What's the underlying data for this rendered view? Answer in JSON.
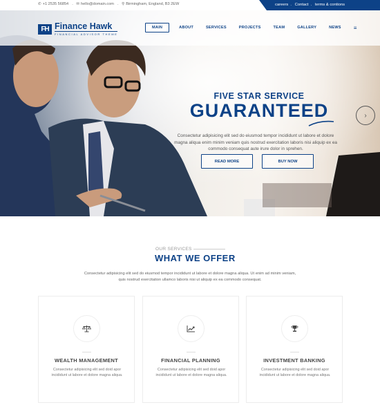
{
  "topbar": {
    "phone": "+1 2535 56854",
    "email": "hello@domain.com",
    "address": "Birmingham, England, B3 2EW",
    "links": [
      "careers",
      "Contact",
      "terms & contions"
    ]
  },
  "brand": {
    "mark": "FH",
    "name": "Finance Hawk",
    "tagline": "FINANCIAL ADVISOR THEME",
    "color": "#0d4287"
  },
  "nav": {
    "items": [
      "MAIN",
      "ABOUT",
      "SERVICES",
      "PROJECTS",
      "TEAM",
      "GALLERY",
      "NEWS"
    ],
    "active": "MAIN",
    "menu_icon": "≡"
  },
  "hero": {
    "kicker": "FIVE STAR SERVICE",
    "title": "GUARANTEED",
    "description": "Consectetur adipisicing elit sed do eiusmod tempor incididunt ut labore et dolore magna aliqua enim minim veniam quis nostrud exercitation laboris nisi aliquip ex ea commodo consequat aute irure dolor in sprehen.",
    "buttons": [
      "READ MORE",
      "BUY NOW"
    ],
    "next_icon": "›"
  },
  "services": {
    "kicker": "OUR SERVICES",
    "title": "WHAT WE OFFER",
    "description": "Consectetur adipisicing elit sed do eiusmod tempor incididunt ut labore et dolore magna aliqua. Ut enim ad minim veniam, quis nostrud exercitation ullamco laboris nisi ut aliquip ex ea commodo consequat.",
    "cards": [
      {
        "icon": "scale-icon",
        "title": "WEALTH MANAGEMENT",
        "description": "Consectetur adipisicing elit sed doid apor incididunt ut labore et dolore magna aliqua."
      },
      {
        "icon": "chart-icon",
        "title": "FINANCIAL PLANNING",
        "description": "Consectetur adipisicing elit sed doid apor incididunt ut labore et dolore magna aliqua."
      },
      {
        "icon": "trophy-icon",
        "title": "INVESTMENT BANKING",
        "description": "Consectetur adipisicing elit sed doid apor incididunt ut labore et dolore magna aliqua."
      }
    ]
  }
}
